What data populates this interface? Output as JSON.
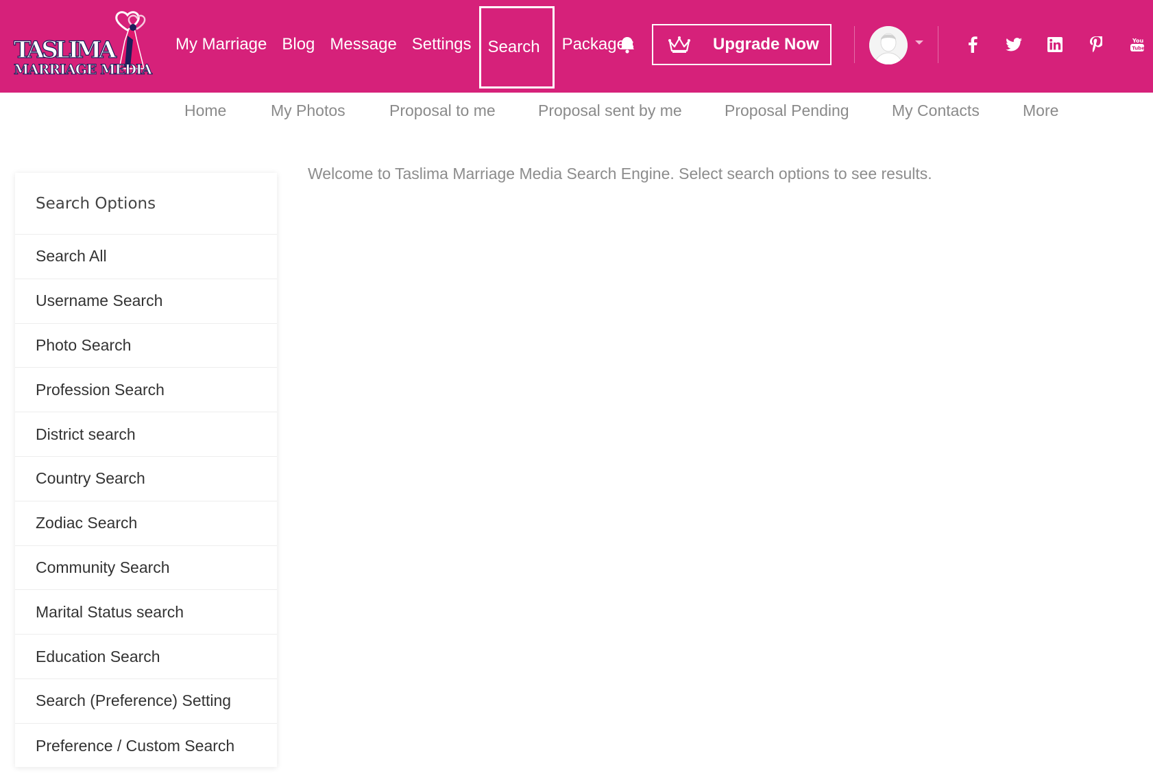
{
  "brand": {
    "logo_line1": "TASLIMA",
    "logo_line2": "MARRIAGE MEDIA",
    "primary_color": "#d6217a"
  },
  "main_nav": {
    "items": [
      {
        "label": "My Marriage"
      },
      {
        "label": "Blog"
      },
      {
        "label": "Message"
      },
      {
        "label": "Settings"
      },
      {
        "label": "Search",
        "active": true
      },
      {
        "label": "Packages"
      }
    ],
    "bell_icon": "bell-icon"
  },
  "upgrade": {
    "label": "Upgrade Now",
    "icon": "crown-icon"
  },
  "user": {
    "avatar_icon": "avatar-icon",
    "menu_icon": "caret-down-icon"
  },
  "social": [
    {
      "name": "facebook-icon"
    },
    {
      "name": "twitter-icon"
    },
    {
      "name": "linkedin-icon"
    },
    {
      "name": "pinterest-icon"
    },
    {
      "name": "youtube-icon"
    }
  ],
  "sub_nav": {
    "items": [
      {
        "label": "Home"
      },
      {
        "label": "My Photos"
      },
      {
        "label": "Proposal to me"
      },
      {
        "label": "Proposal sent by me"
      },
      {
        "label": "Proposal Pending"
      },
      {
        "label": "My Contacts"
      },
      {
        "label": "More"
      }
    ]
  },
  "sidebar": {
    "title": "Search Options",
    "items": [
      {
        "label": "Search All"
      },
      {
        "label": "Username Search"
      },
      {
        "label": "Photo Search"
      },
      {
        "label": "Profession Search"
      },
      {
        "label": "District search"
      },
      {
        "label": "Country Search"
      },
      {
        "label": "Zodiac Search"
      },
      {
        "label": "Community Search"
      },
      {
        "label": "Marital Status search"
      },
      {
        "label": "Education Search"
      },
      {
        "label": "Search (Preference) Setting"
      },
      {
        "label": "Preference / Custom Search"
      }
    ]
  },
  "main": {
    "welcome_text": "Welcome to Taslima Marriage Media Search Engine. Select search options to see results."
  }
}
